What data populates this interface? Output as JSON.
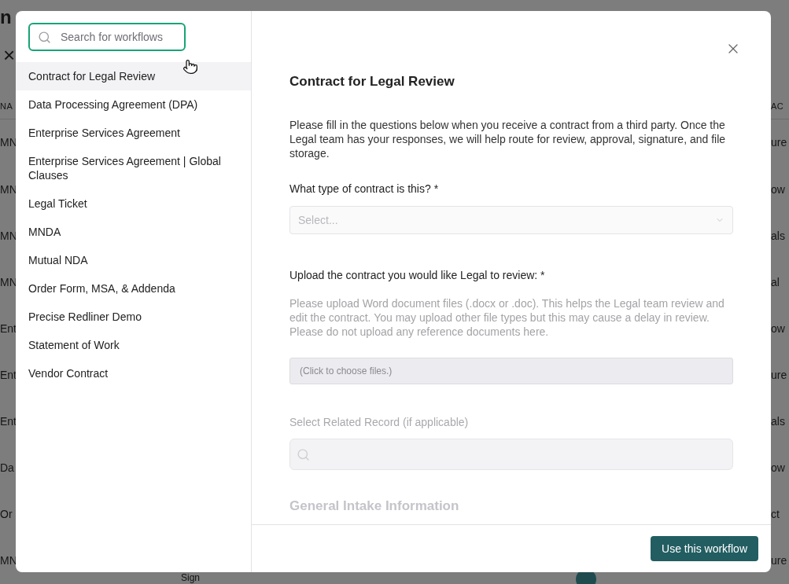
{
  "background": {
    "title": "n",
    "close_mark": "×",
    "left_header": "NA",
    "right_header": "AC",
    "rows": [
      {
        "left": "MN",
        "right": "ure"
      },
      {
        "left": "MN",
        "right": "ow"
      },
      {
        "left": "MN",
        "right": "als"
      },
      {
        "left": "MN",
        "right": "al"
      },
      {
        "left": "Ent",
        "right": "ow"
      },
      {
        "left": "Ent",
        "right": "ure"
      },
      {
        "left": "Ent",
        "right": "als"
      },
      {
        "left": "Da",
        "right": "ow"
      },
      {
        "left": "Or",
        "right": "ct"
      },
      {
        "left": "MN",
        "right": "ure"
      }
    ],
    "footer_text": "Sign"
  },
  "dialog": {
    "search": {
      "placeholder": "Search for workflows",
      "focused": true
    },
    "workflows": [
      {
        "label": "Contract for Legal Review",
        "selected": true
      },
      {
        "label": "Data Processing Agreement (DPA)",
        "selected": false
      },
      {
        "label": "Enterprise Services Agreement",
        "selected": false
      },
      {
        "label": "Enterprise Services Agreement | Global Clauses",
        "selected": false
      },
      {
        "label": "Legal Ticket",
        "selected": false
      },
      {
        "label": "MNDA",
        "selected": false
      },
      {
        "label": "Mutual NDA",
        "selected": false
      },
      {
        "label": "Order Form, MSA, & Addenda",
        "selected": false
      },
      {
        "label": "Precise Redliner Demo",
        "selected": false
      },
      {
        "label": "Statement of Work",
        "selected": false
      },
      {
        "label": "Vendor Contract",
        "selected": false
      }
    ],
    "form": {
      "title": "Contract for Legal Review",
      "intro": "Please fill in the questions below when you receive a contract from a third party. Once the Legal team has your responses, we will help route for review, approval, signature, and file storage.",
      "fields": [
        {
          "kind": "select",
          "label": "What type of contract is this? *",
          "placeholder": "Select..."
        },
        {
          "kind": "file",
          "label": "Upload the contract you would like Legal to review: *",
          "help": "Please upload Word document files (.docx or .doc). This helps the Legal team review and edit the contract. You may upload other file types but this may cause a delay in review. Please do not upload any reference documents here.",
          "placeholder": "(Click to choose files.)"
        },
        {
          "kind": "search",
          "label": "Select Related Record (if applicable)"
        }
      ],
      "section_heading": "General Intake Information"
    },
    "primary_button": "Use this workflow"
  }
}
